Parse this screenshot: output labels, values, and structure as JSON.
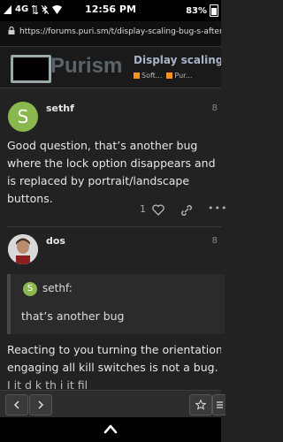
{
  "status_bar": {
    "signal": "4G",
    "time": "12:56 PM",
    "battery": "83%"
  },
  "browser": {
    "url": "https://forums.puri.sm/t/display-scaling-bug-s-after-upgr"
  },
  "forum_header": {
    "logo_text": "Purism",
    "topic_title": "Display scaling b",
    "categories": [
      {
        "label": "Soft...",
        "color": "#f7941d"
      },
      {
        "label": "Pur...",
        "color": "#f7941d"
      }
    ]
  },
  "posts": [
    {
      "username": "sethf",
      "avatar_letter": "S",
      "avatar_color": "#8bb84e",
      "post_number": "8",
      "body": "Good question, that’s another bug where the lock option disappears and is replaced by portrait/landscape buttons.",
      "like_count": "1",
      "more_label": "•••"
    },
    {
      "username": "dos",
      "post_number": "8",
      "quote": {
        "username": "sethf:",
        "avatar_letter": "S",
        "text": "that’s another bug"
      },
      "body_lines": [
        "Reacting to you turning the orientation senso",
        "engaging all kill switches is not a bug."
      ],
      "partial_line": "I    it    d    k    th    i          it              fil"
    }
  ],
  "bottom_toolbar": {
    "back_label": "<",
    "forward_label": ">"
  }
}
